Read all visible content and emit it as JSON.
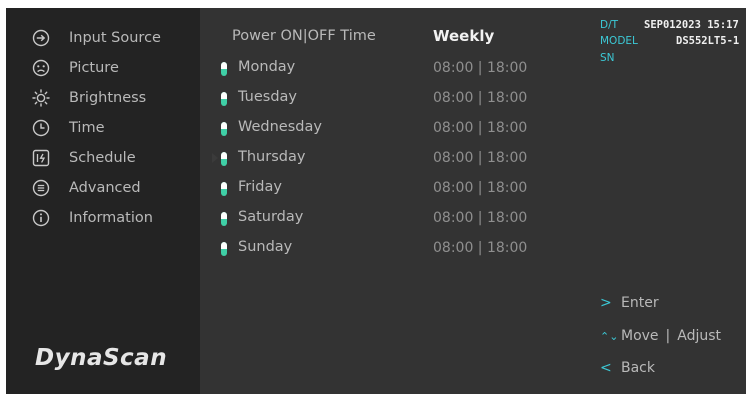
{
  "sidebar": {
    "items": [
      {
        "label": "Input Source",
        "icon": "input-source-icon"
      },
      {
        "label": "Picture",
        "icon": "picture-icon"
      },
      {
        "label": "Brightness",
        "icon": "brightness-icon"
      },
      {
        "label": "Time",
        "icon": "clock-icon"
      },
      {
        "label": "Schedule",
        "icon": "schedule-icon"
      },
      {
        "label": "Advanced",
        "icon": "advanced-icon"
      },
      {
        "label": "Information",
        "icon": "information-icon"
      }
    ],
    "logo": "DynaScan"
  },
  "main": {
    "title": "Power ON|OFF Time",
    "mode": "Weekly",
    "days": [
      {
        "day": "Monday",
        "time": "08:00 | 18:00",
        "enabled": true
      },
      {
        "day": "Tuesday",
        "time": "08:00 | 18:00",
        "enabled": true
      },
      {
        "day": "Wednesday",
        "time": "08:00 | 18:00",
        "enabled": true
      },
      {
        "day": "Thursday",
        "time": "08:00 | 18:00",
        "enabled": true,
        "selected": true
      },
      {
        "day": "Friday",
        "time": "08:00 | 18:00",
        "enabled": true
      },
      {
        "day": "Saturday",
        "time": "08:00 | 18:00",
        "enabled": true
      },
      {
        "day": "Sunday",
        "time": "08:00 | 18:00",
        "enabled": true
      }
    ]
  },
  "info": {
    "dt_label": "D/T",
    "dt_value": "SEP012023 15:17",
    "model_label": "MODEL",
    "model_value": "DS552LT5-1",
    "sn_label": "SN",
    "sn_value": ""
  },
  "hints": {
    "enter_glyph": ">",
    "enter": "Enter",
    "move_glyph": "⌃⌄",
    "move": "Move",
    "adjust": "Adjust",
    "back_glyph": "<",
    "back": "Back"
  },
  "colors": {
    "accent": "#3cc9d6",
    "toggle_on": "#3fcfa6",
    "sidebar_bg": "#232323",
    "main_bg": "#333333"
  }
}
